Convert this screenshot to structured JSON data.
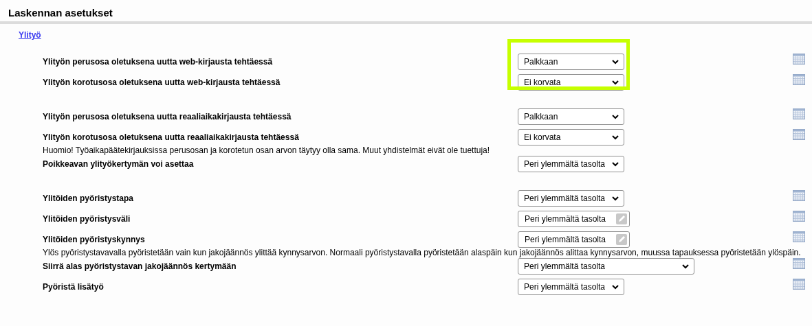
{
  "title": "Laskennan asetukset",
  "section_link": "Ylityö",
  "groups": [
    {
      "highlighted": true,
      "items": [
        {
          "kind": "select",
          "label": "Ylityön perusosa oletuksena uutta web-kirjausta tehtäessä",
          "value": "Palkkaan",
          "wide": false,
          "history": true
        },
        {
          "kind": "select",
          "label": "Ylityön korotusosa oletuksena uutta web-kirjausta tehtäessä",
          "value": "Ei korvata",
          "wide": false,
          "history": true
        }
      ]
    },
    {
      "highlighted": false,
      "items": [
        {
          "kind": "select",
          "label": "Ylityön perusosa oletuksena uutta reaaliaikakirjausta tehtäessä",
          "value": "Palkkaan",
          "wide": false,
          "history": true
        },
        {
          "kind": "select",
          "label": "Ylityön korotusosa oletuksena uutta reaaliaikakirjausta tehtäessä",
          "value": "Ei korvata",
          "wide": false,
          "history": true
        },
        {
          "kind": "note",
          "text": "Huomio! Työaikapäätekirjauksissa perusosan ja korotetun osan arvon täytyy olla sama. Muut yhdistelmät eivät ole tuettuja!"
        },
        {
          "kind": "select",
          "label": "Poikkeavan ylityökertymän voi asettaa",
          "value": "Peri ylemmältä tasolta",
          "wide": false,
          "history": false
        }
      ]
    },
    {
      "highlighted": false,
      "items": [
        {
          "kind": "select",
          "label": "Ylitöiden pyöristystapa",
          "value": "Peri ylemmältä tasolta",
          "wide": false,
          "history": true
        },
        {
          "kind": "text",
          "label": "Ylitöiden pyöristysväli",
          "value": "Peri ylemmältä tasolta",
          "history": true
        },
        {
          "kind": "text",
          "label": "Ylitöiden pyöristyskynnys",
          "value": "Peri ylemmältä tasolta",
          "history": true
        },
        {
          "kind": "note",
          "text": "Ylös pyöristystavavalla pyöristetään vain kun jakojäännös ylittää kynnysarvon. Normaali pyöristystavalla pyöristetään alaspäin kun jakojäännös alittaa kynnysarvon, muussa tapauksessa pyöristetään ylöspäin."
        },
        {
          "kind": "select",
          "label": "Siirrä alas pyöristystavan jakojäännös kertymään",
          "value": "Peri ylemmältä tasolta",
          "wide": true,
          "history": true
        },
        {
          "kind": "select",
          "label": "Pyöristä lisätyö",
          "value": "Peri ylemmältä tasolta",
          "wide": false,
          "history": true
        }
      ]
    }
  ]
}
